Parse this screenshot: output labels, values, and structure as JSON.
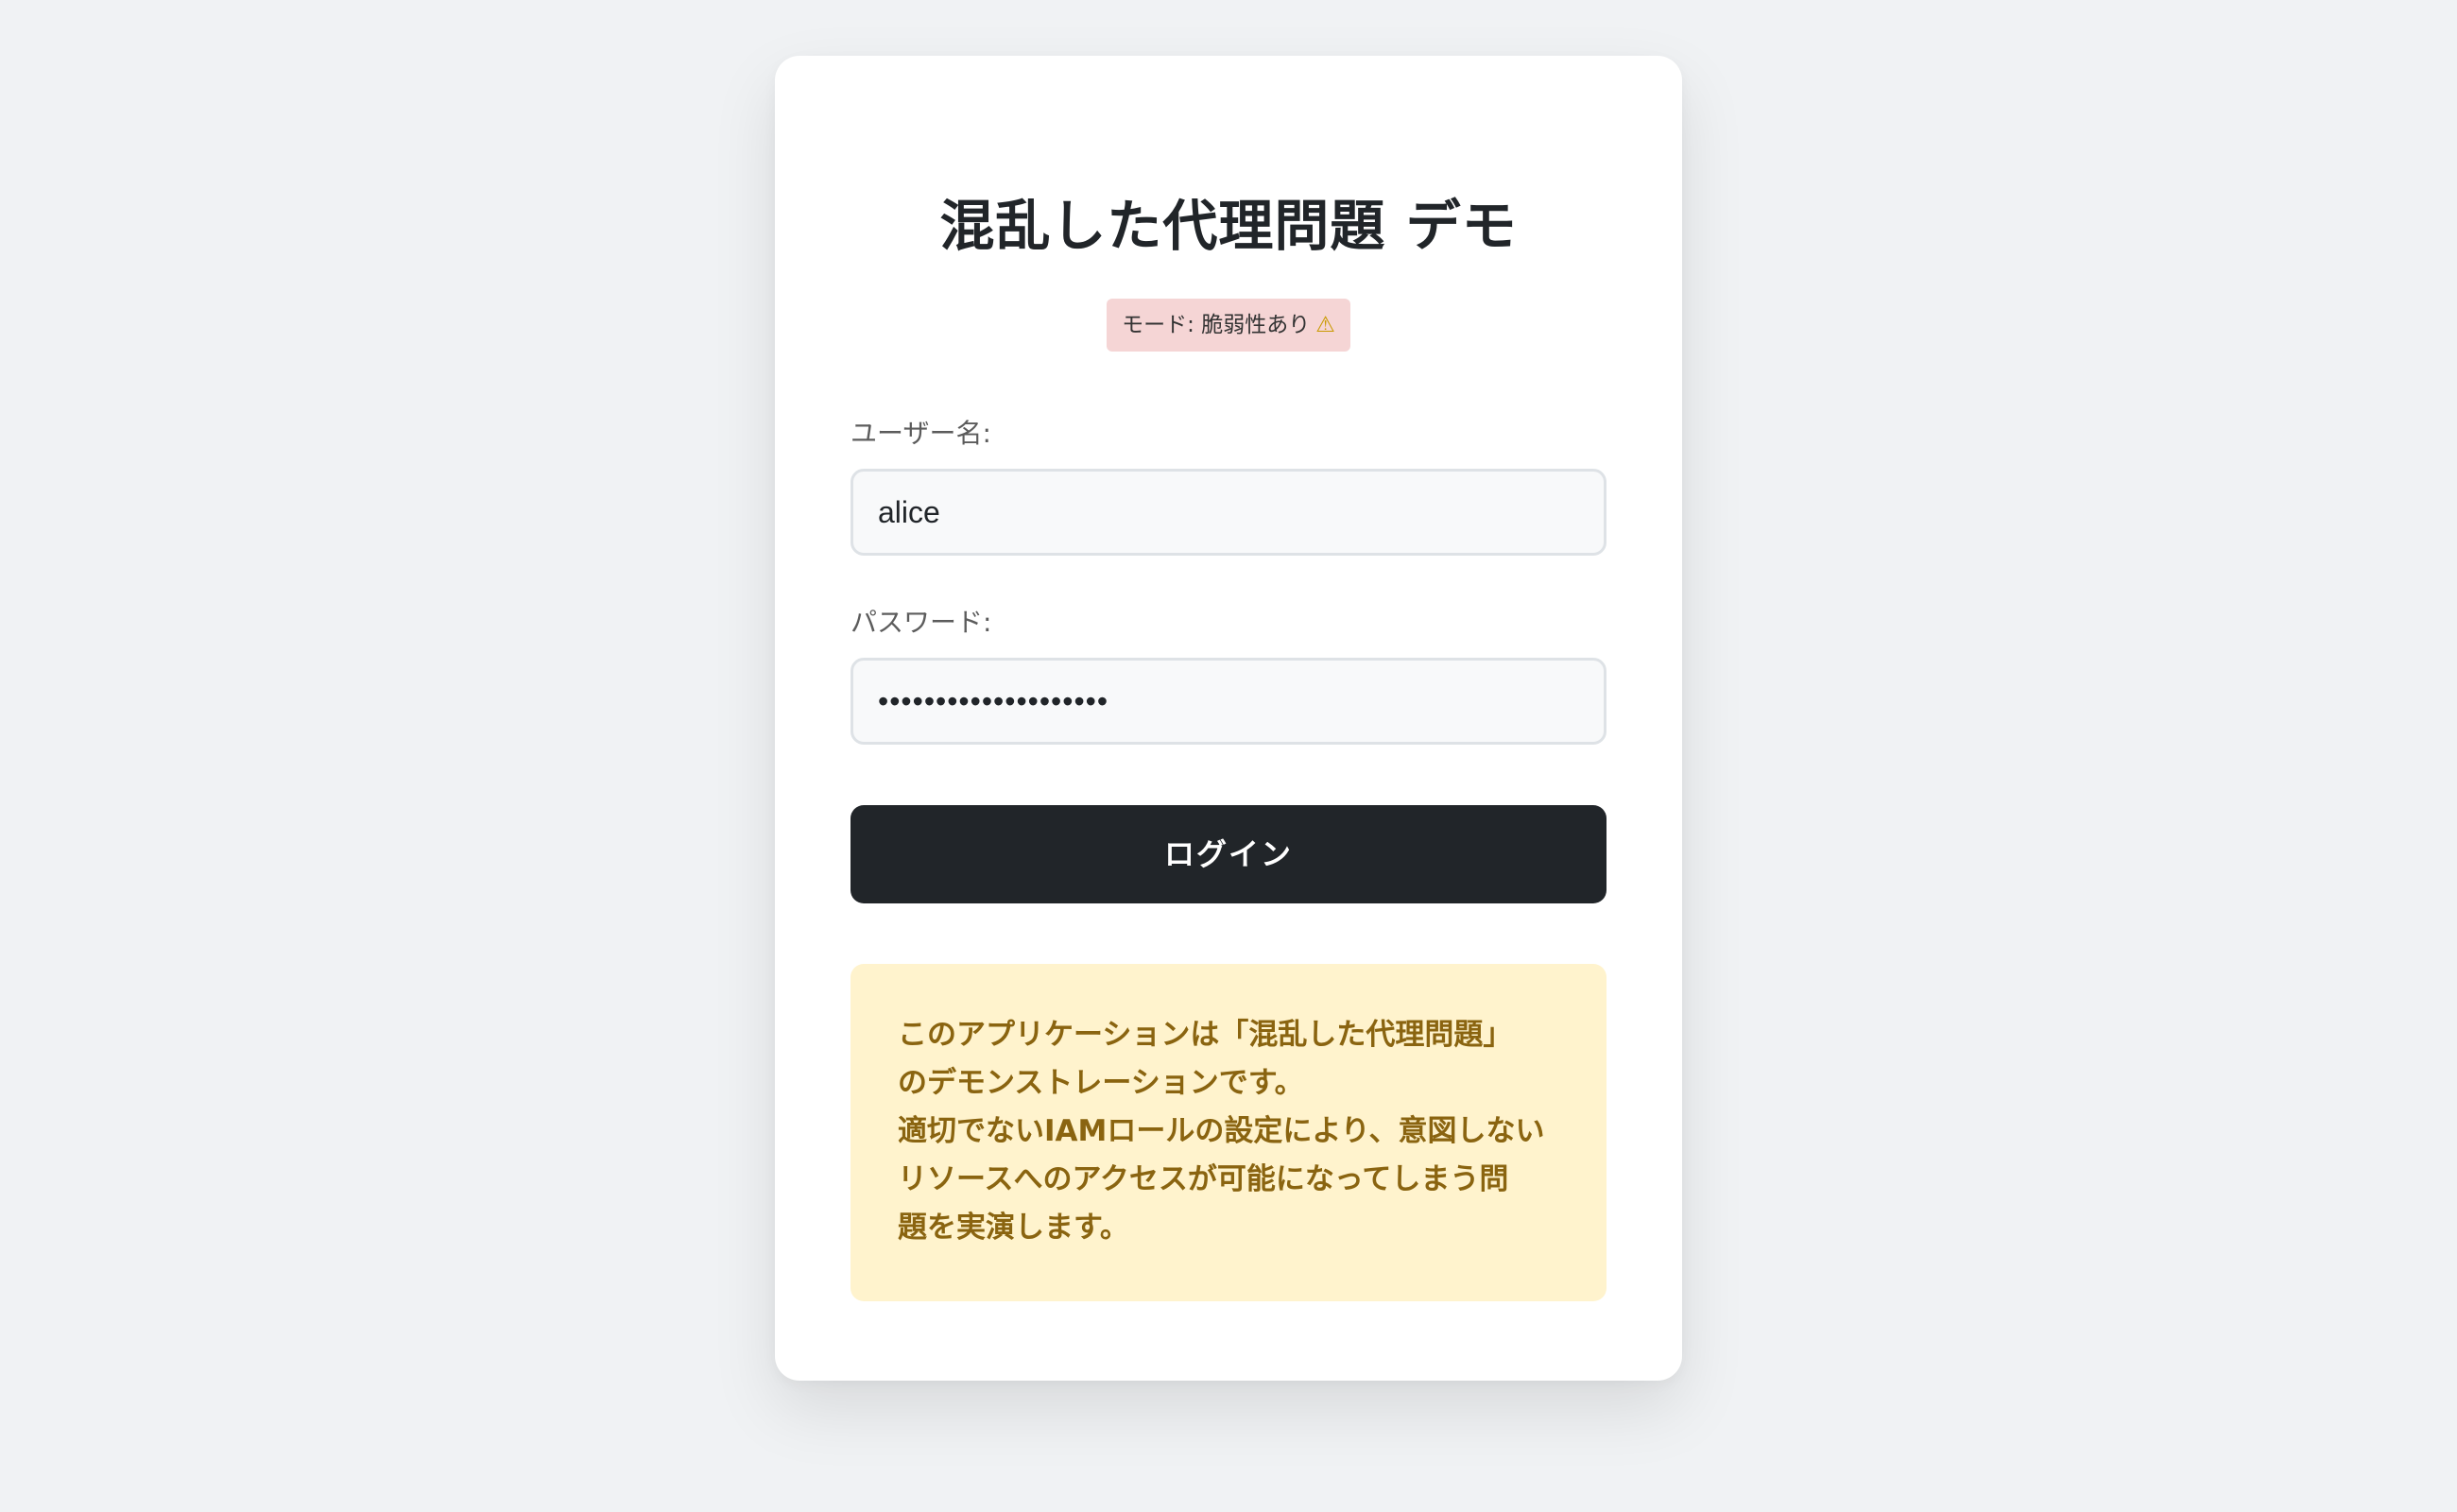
{
  "page": {
    "title": "混乱した代理問題 デモ",
    "mode_badge": "モード: 脆弱性あり",
    "mode_badge_icon": "warning-icon",
    "colors": {
      "background": "#f0f2f4",
      "card": "#ffffff",
      "badge_bg": "#f5d5d5",
      "button_bg": "#212529",
      "info_bg": "#fff3cd",
      "info_text": "#8a6410"
    }
  },
  "form": {
    "username_label": "ユーザー名:",
    "username_value": "alice",
    "password_label": "パスワード:",
    "password_value": "••••••••••••••••••••",
    "login_button": "ログイン"
  },
  "info_box": {
    "lines": [
      "このアプリケーションは「混乱した代理問題」",
      "のデモンストレーションです。",
      "適切でないIAMロールの設定により、意図しない",
      "リソースへのアクセスが可能になってしまう問",
      "題を実演します。"
    ]
  }
}
